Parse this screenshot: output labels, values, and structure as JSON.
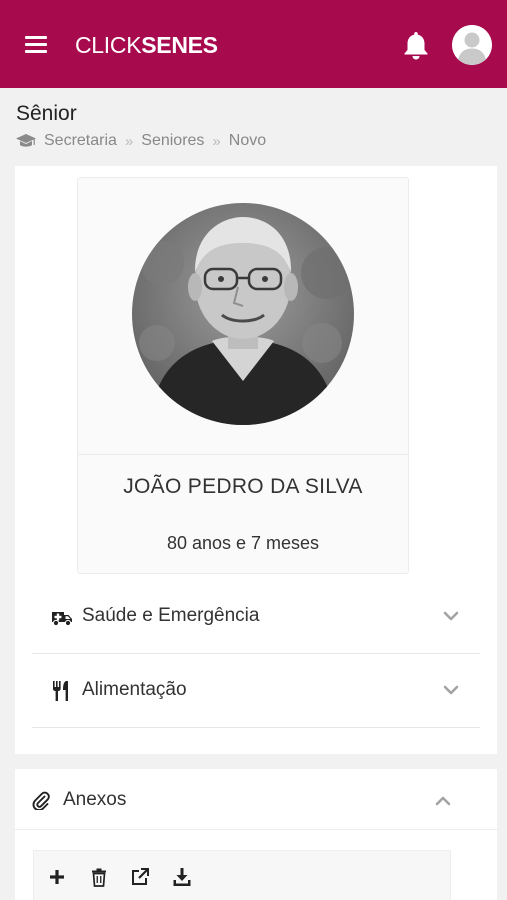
{
  "header": {
    "logo_light": "CLICK",
    "logo_bold": "SENES",
    "brand_color": "#a80a4e",
    "icons": [
      "menu-icon",
      "bell-icon",
      "user-avatar-icon"
    ]
  },
  "page": {
    "title": "Sênior",
    "breadcrumb": [
      "Secretaria",
      "Seniores",
      "Novo"
    ],
    "breadcrumb_icon": "graduation-cap-icon",
    "breadcrumb_separator": "»"
  },
  "profile": {
    "name": "JOÃO PEDRO DA SILVA",
    "age": "80 anos e 7 meses"
  },
  "sections": [
    {
      "label": "Saúde e Emergência",
      "icon": "ambulance-icon",
      "expanded": false
    },
    {
      "label": "Alimentação",
      "icon": "utensils-icon",
      "expanded": false
    }
  ],
  "attachments": {
    "label": "Anexos",
    "icon": "paperclip-icon",
    "expanded": true,
    "toolbar": [
      "add-icon",
      "trash-icon",
      "external-link-icon",
      "download-icon"
    ]
  }
}
